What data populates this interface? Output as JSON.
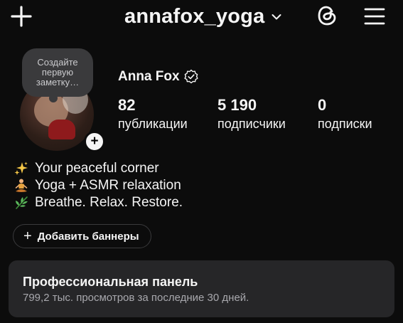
{
  "header": {
    "username": "annafox_yoga",
    "icons": [
      "plus-icon",
      "chevron-down-icon",
      "threads-icon",
      "menu-icon"
    ]
  },
  "profile": {
    "note_prompt": "Создайте первую заметку…",
    "display_name": "Anna Fox",
    "stats": [
      {
        "value": "82",
        "label": "публикации"
      },
      {
        "value": "5 190",
        "label": "подписчики"
      },
      {
        "value": "0",
        "label": "подписки"
      }
    ],
    "bio": [
      {
        "emoji": "sparkles-icon",
        "text": "Your peaceful corner"
      },
      {
        "emoji": "yoga-person-icon",
        "text": "Yoga + ASMR relaxation"
      },
      {
        "emoji": "herb-icon",
        "text": "Breathe. Relax. Restore."
      }
    ]
  },
  "banner_button": {
    "label": "Добавить баннеры"
  },
  "pro_panel": {
    "title": "Профессиональная панель",
    "subtitle": "799,2 тыс. просмотров за последние 30 дней."
  },
  "colors": {
    "background": "#0c0c0c",
    "text": "#f5f5f5",
    "panel": "#262628",
    "muted": "#a8a8ad",
    "bubble": "#3a3a3c"
  }
}
